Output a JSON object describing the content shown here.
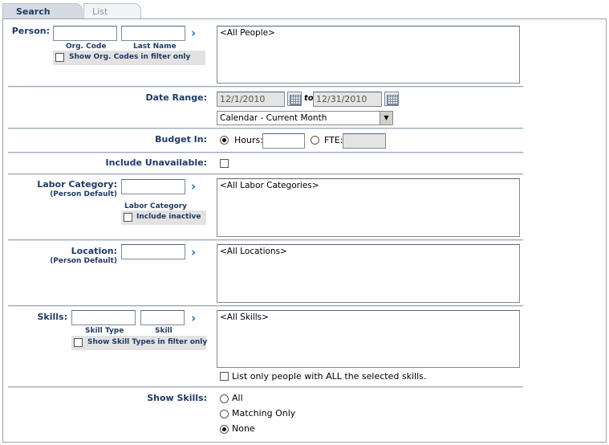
{
  "tabs": {
    "search": "Search",
    "list": "List"
  },
  "person": {
    "label": "Person:",
    "org_code_label": "Org. Code",
    "last_name_label": "Last Name",
    "show_org_codes": "Show Org. Codes in filter only",
    "list_default": "<All People>"
  },
  "date_range": {
    "label": "Date Range:",
    "from": "12/1/2010",
    "to_label": "to",
    "to": "12/31/2010",
    "preset": "Calendar - Current Month"
  },
  "budget_in": {
    "label": "Budget In:",
    "hours_label": "Hours:",
    "fte_label": "FTE:"
  },
  "include_unavailable": {
    "label": "Include Unavailable:"
  },
  "labor_category": {
    "label": "Labor Category:",
    "sublabel": "(Person Default)",
    "field_label": "Labor Category",
    "include_inactive": "Include inactive",
    "list_default": "<All Labor Categories>"
  },
  "location": {
    "label": "Location:",
    "sublabel": "(Person Default)",
    "list_default": "<All Locations>"
  },
  "skills": {
    "label": "Skills:",
    "skill_type_label": "Skill Type",
    "skill_label": "Skill",
    "show_skill_types": "Show Skill Types in filter only",
    "list_default": "<All Skills>",
    "list_all_selected": "List only people with ALL the selected skills."
  },
  "show_skills": {
    "label": "Show Skills:",
    "options": [
      "All",
      "Matching Only",
      "None"
    ],
    "selected": "None"
  }
}
